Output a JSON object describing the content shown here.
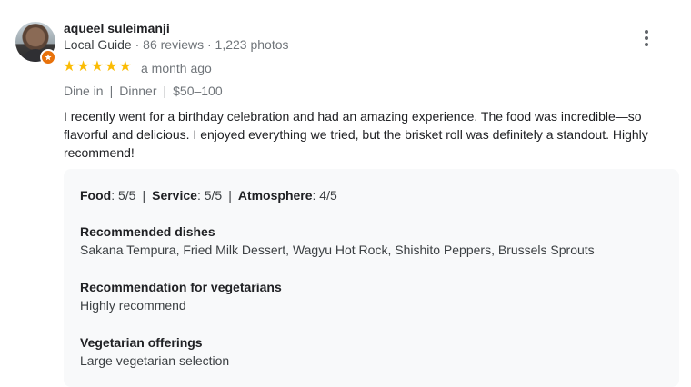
{
  "reviewer": {
    "name": "aqueel suleimanji",
    "guide_label": "Local Guide",
    "reviews": "86 reviews",
    "photos": "1,223 photos"
  },
  "rating": {
    "stars": 5,
    "max": 5,
    "time": "a month ago"
  },
  "attributes": [
    "Dine in",
    "Dinner",
    "$50–100"
  ],
  "review_text": "I recently went for a birthday celebration and had an amazing experience. The food was incredible—so flavorful and delicious. I enjoyed everything we tried, but the brisket roll was definitely a standout. Highly recommend!",
  "details": {
    "food_label": "Food",
    "food_value": ": 5/5",
    "service_label": "Service",
    "service_value": ": 5/5",
    "atmosphere_label": "Atmosphere",
    "atmosphere_value": ": 4/5",
    "sections": [
      {
        "title": "Recommended dishes",
        "value": "Sakana Tempura, Fried Milk Dessert, Wagyu Hot Rock, Shishito Peppers, Brussels Sprouts"
      },
      {
        "title": "Recommendation for vegetarians",
        "value": "Highly recommend"
      },
      {
        "title": "Vegetarian offerings",
        "value": "Large vegetarian selection"
      }
    ]
  },
  "colors": {
    "star": "#fbbc04",
    "badge": "#e8710a",
    "panel": "#f8f9fa"
  },
  "icons": {
    "more": "more-vert-icon",
    "badge": "local-guide-badge-icon",
    "star": "star-icon"
  }
}
